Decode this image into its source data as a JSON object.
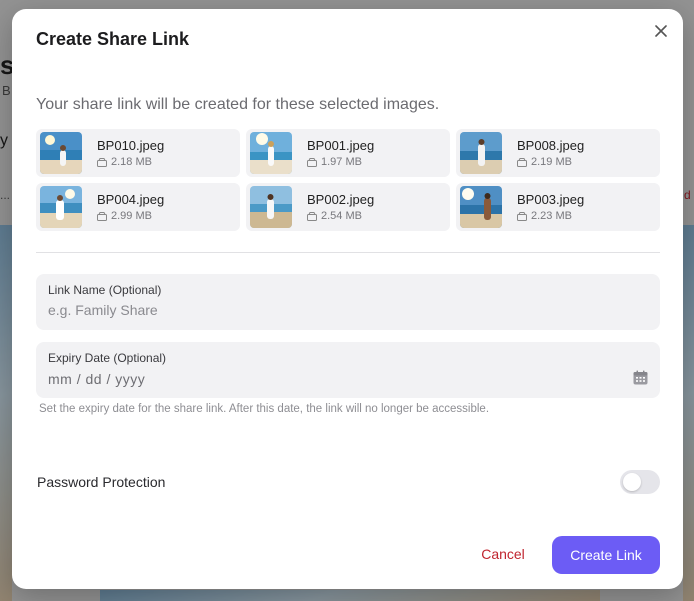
{
  "background": {
    "fragment_1": "st",
    "fragment_2": "B",
    "fragment_3": "y",
    "fragment_4": "...",
    "fragment_5": "d"
  },
  "modal": {
    "title": "Create Share Link",
    "close_icon": "close-icon",
    "subtitle": "Your share link will be created for these selected images.",
    "files": [
      {
        "name": "BP010.jpeg",
        "size": "2.18 MB"
      },
      {
        "name": "BP001.jpeg",
        "size": "1.97 MB"
      },
      {
        "name": "BP008.jpeg",
        "size": "2.19 MB"
      },
      {
        "name": "BP004.jpeg",
        "size": "2.99 MB"
      },
      {
        "name": "BP002.jpeg",
        "size": "2.54 MB"
      },
      {
        "name": "BP003.jpeg",
        "size": "2.23 MB"
      }
    ],
    "link_name": {
      "label": "Link Name (Optional)",
      "placeholder": "e.g. Family Share",
      "value": ""
    },
    "expiry_date": {
      "label": "Expiry Date (Optional)",
      "value": "mm / dd / yyyy",
      "icon": "calendar-icon"
    },
    "helper_text": "Set the expiry date for the share link. After this date, the link will no longer be accessible.",
    "password_protection": {
      "label": "Password Protection",
      "enabled": false
    },
    "cancel_label": "Cancel",
    "create_label": "Create Link",
    "colors": {
      "accent": "#6c5cf5",
      "danger": "#c0252f"
    }
  }
}
